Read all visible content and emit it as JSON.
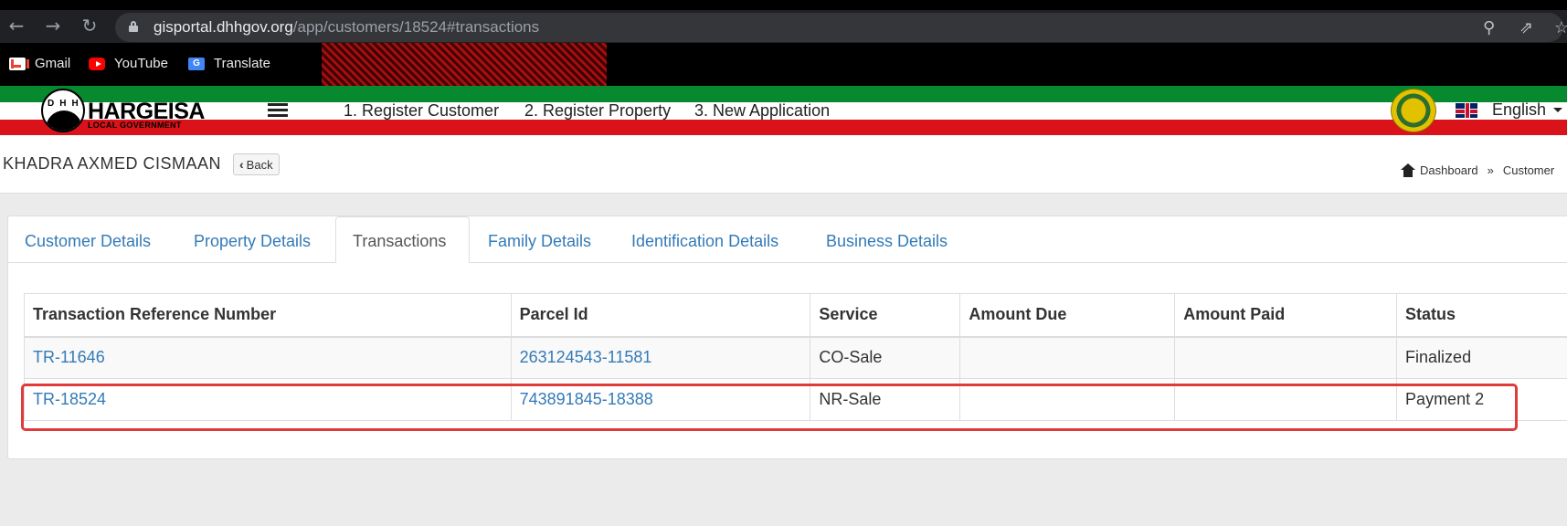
{
  "browser": {
    "url_host": "gisportal.dhhgov.org",
    "url_path": "/app/customers/18524#transactions",
    "back_icon": "arrow-left-icon",
    "forward_icon": "arrow-right-icon",
    "reload_icon": "reload-icon",
    "zoom_icon": "magnifier-icon",
    "share_icon": "share-icon",
    "bookmark_icon": "star-icon"
  },
  "bookmarks": [
    {
      "label": "Gmail",
      "icon": "gmail-icon"
    },
    {
      "label": "YouTube",
      "icon": "youtube-icon"
    },
    {
      "label": "Translate",
      "icon": "translate-icon"
    }
  ],
  "header": {
    "logo_letters": "DHH",
    "brand": "HARGEISA",
    "brand_sub": "LOCAL GOVERNMENT",
    "menu_items": [
      "1. Register Customer",
      "2. Register Property",
      "3. New Application"
    ],
    "language": "English",
    "flag_colors": {
      "green": "#078930",
      "red": "#da121a"
    }
  },
  "page": {
    "customer_name": "KHADRA AXMED CISMAAN",
    "back_label": "Back",
    "breadcrumbs": [
      "Dashboard",
      "Customer"
    ],
    "breadcrumb_separator": "»"
  },
  "tabs": [
    {
      "label": "Customer Details",
      "active": false
    },
    {
      "label": "Property Details",
      "active": false
    },
    {
      "label": "Transactions",
      "active": true
    },
    {
      "label": "Family Details",
      "active": false
    },
    {
      "label": "Identification Details",
      "active": false
    },
    {
      "label": "Business Details",
      "active": false
    }
  ],
  "table": {
    "headers": [
      "Transaction Reference Number",
      "Parcel Id",
      "Service",
      "Amount Due",
      "Amount Paid",
      "Status"
    ],
    "rows": [
      {
        "ref": "TR-11646",
        "parcel": "263124543-11581",
        "service": "CO-Sale",
        "amount_due": "",
        "amount_paid": "",
        "status": "Finalized"
      },
      {
        "ref": "TR-18524",
        "parcel": "743891845-18388",
        "service": "NR-Sale",
        "amount_due": "",
        "amount_paid": "",
        "status": "Payment 2",
        "highlighted": true
      }
    ]
  },
  "colors": {
    "link": "#337ab7",
    "highlight_border": "#e03a3a"
  }
}
